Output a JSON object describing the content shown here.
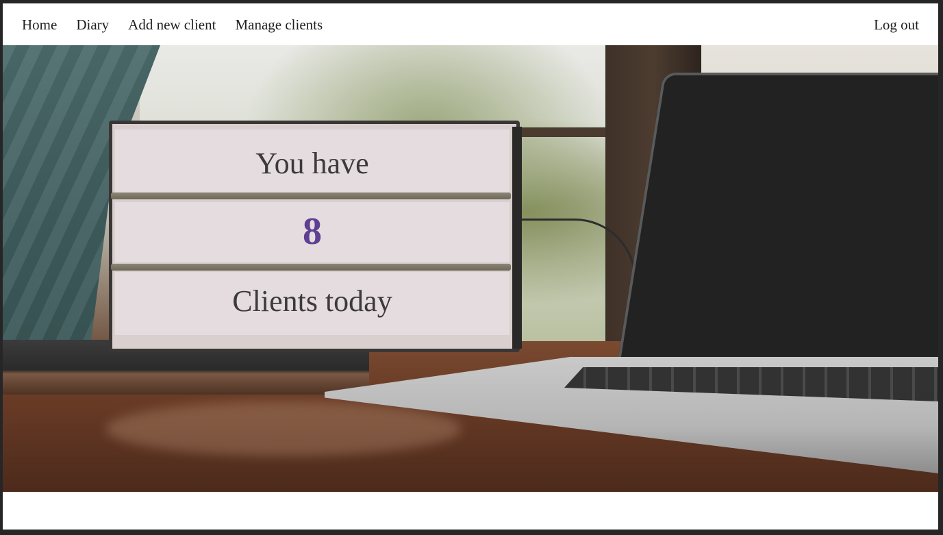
{
  "nav": {
    "links": [
      "Home",
      "Diary",
      "Add new client",
      "Manage clients"
    ],
    "logout": "Log out"
  },
  "lightbox": {
    "line1": "You have",
    "count": "8",
    "line3": "Clients today"
  },
  "colors": {
    "count_accent": "#5e3f92",
    "nav_text": "#1e1e1e",
    "page_border": "#262626"
  }
}
